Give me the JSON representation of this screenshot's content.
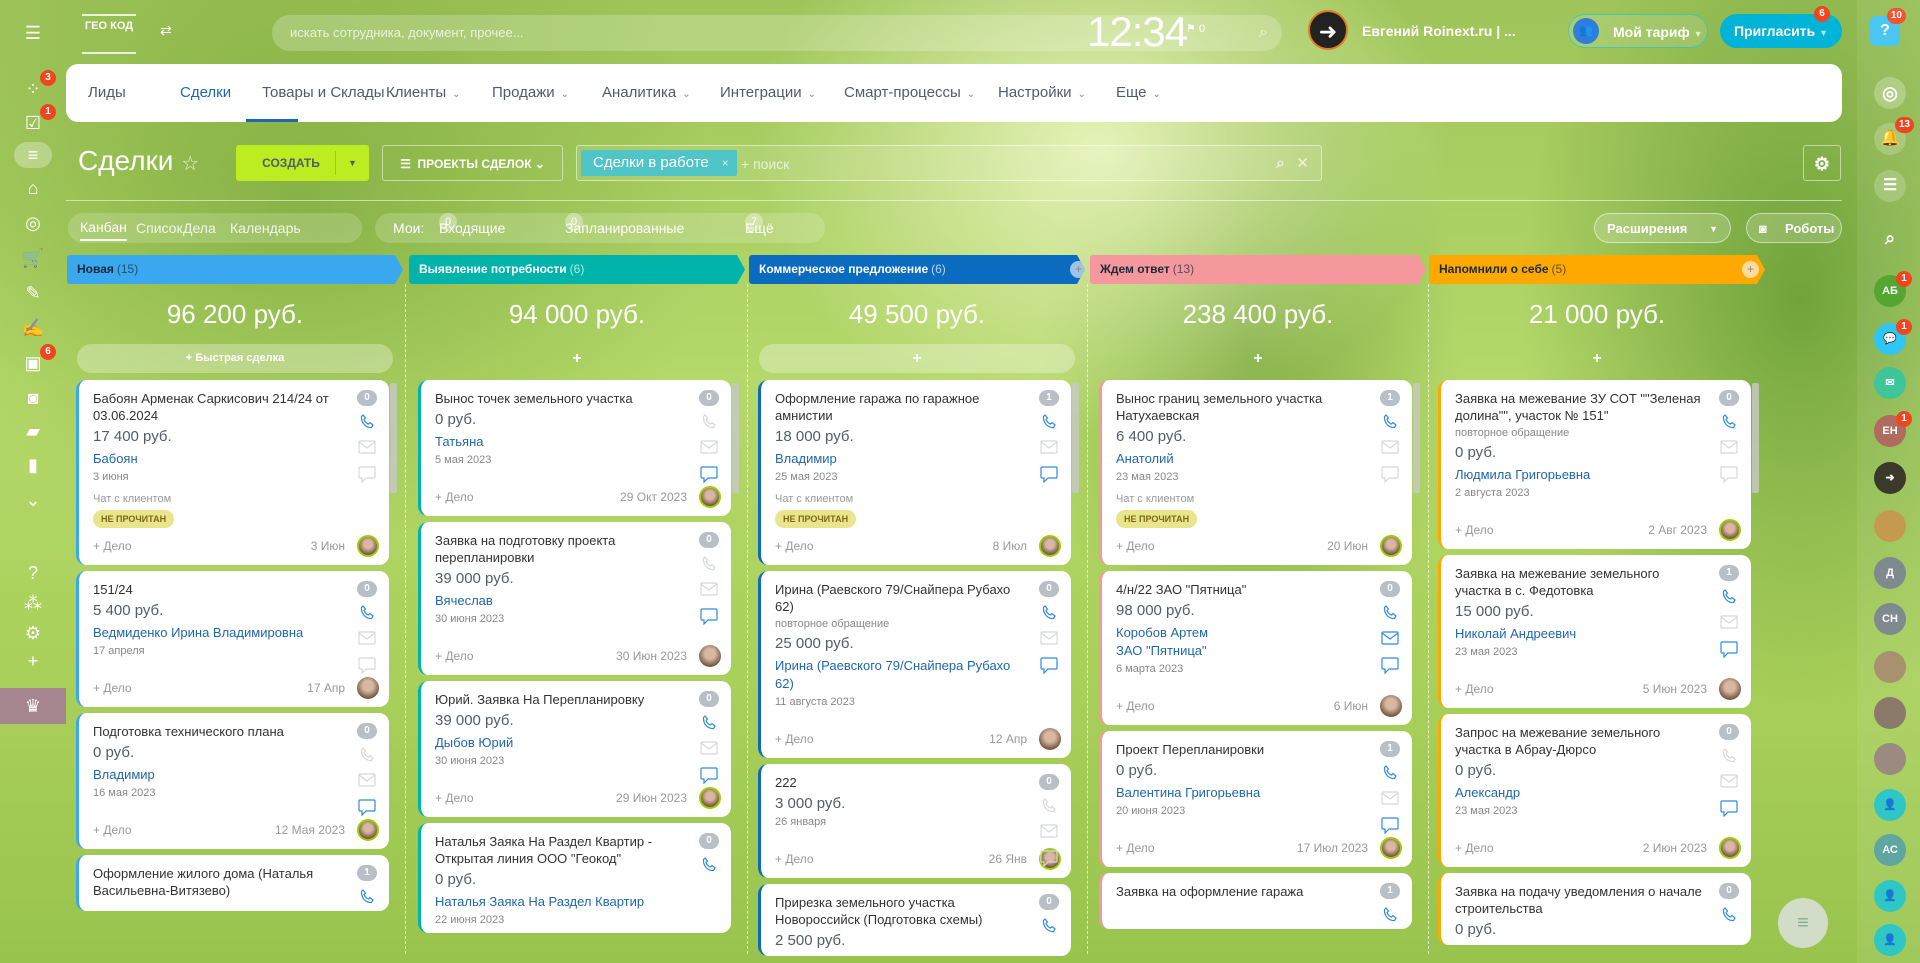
{
  "left_sidebar": {
    "items": [
      {
        "icon": "menu-icon",
        "glyph": "☰",
        "badge": null
      },
      {
        "icon": "feed-icon",
        "glyph": "⁘",
        "badge": "3"
      },
      {
        "icon": "tasks-icon",
        "glyph": "☑",
        "badge": "1"
      },
      {
        "icon": "crm-filter-icon",
        "glyph": "≡",
        "badge": null
      },
      {
        "icon": "store-icon",
        "glyph": "⌂",
        "badge": null
      },
      {
        "icon": "target-icon",
        "glyph": "◎",
        "badge": null
      },
      {
        "icon": "cart-icon",
        "glyph": "🛒",
        "badge": null
      },
      {
        "icon": "document-edit-icon",
        "glyph": "✎",
        "badge": null
      },
      {
        "icon": "signature-icon",
        "glyph": "✍",
        "badge": null
      },
      {
        "icon": "contact-card-icon",
        "glyph": "▣",
        "badge": "6"
      },
      {
        "icon": "robot-icon",
        "glyph": "◙",
        "badge": null
      },
      {
        "icon": "box-icon",
        "glyph": "▰",
        "badge": null
      },
      {
        "icon": "analytics-icon",
        "glyph": "▮",
        "badge": null
      },
      {
        "icon": "more-icon",
        "glyph": "⌄",
        "badge": null
      },
      {
        "icon": "help-icon",
        "glyph": "?",
        "badge": null
      },
      {
        "icon": "sitemap-icon",
        "glyph": "⁂",
        "badge": null
      },
      {
        "icon": "settings-icon",
        "glyph": "⚙",
        "badge": null
      },
      {
        "icon": "add-icon",
        "glyph": "+",
        "badge": null
      },
      {
        "icon": "crown-icon",
        "glyph": "♛",
        "badge": null
      }
    ]
  },
  "header": {
    "logo_text": "ГЕО КОД",
    "search_placeholder": "искать сотрудника, документ, прочее...",
    "clock": "12:34",
    "flag_count": "0",
    "user_name": "Евгений Roinext.ru | ...",
    "tariff_label": "Мой тариф",
    "invite_label": "Пригласить",
    "invite_badge": "6",
    "help_badge": "10"
  },
  "nav": {
    "items": [
      {
        "label": "Лиды",
        "dropdown": false
      },
      {
        "label": "Сделки",
        "dropdown": false,
        "active": true
      },
      {
        "label": "Товары и Склады",
        "dropdown": true
      },
      {
        "label": "Клиенты",
        "dropdown": true
      },
      {
        "label": "Продажи",
        "dropdown": true
      },
      {
        "label": "Аналитика",
        "dropdown": true
      },
      {
        "label": "Интеграции",
        "dropdown": true
      },
      {
        "label": "Смарт-процессы",
        "dropdown": true
      },
      {
        "label": "Настройки",
        "dropdown": true
      },
      {
        "label": "Еще",
        "dropdown": true
      }
    ]
  },
  "toolbar": {
    "title": "Сделки",
    "create_label": "СОЗДАТЬ",
    "projects_label": "ПРОЕКТЫ СДЕЛОК",
    "filter_tag": "Сделки в работе",
    "search_placeholder": "+ поиск"
  },
  "views": {
    "tabs": [
      "Канбан",
      "Список",
      "Дела",
      "Календарь"
    ],
    "my_label": "Мои:",
    "counters": [
      {
        "count": "0",
        "label": "Входящие"
      },
      {
        "count": "0",
        "label": "Запланированные"
      },
      {
        "count": "7",
        "label": "Ещё"
      }
    ],
    "extensions_label": "Расширения",
    "robots_label": "Роботы"
  },
  "columns": [
    {
      "title": "Новая",
      "count": "(15)",
      "sum": "96 200 руб.",
      "color": "#39a8ef",
      "text_color": "#1a2a3a",
      "quick": "Быстрая сделка",
      "cards": [
        {
          "title": "Бабоян Арменак Саркисович 214/24 от 03.06.2024",
          "amount": "17 400 руб.",
          "contacts": [
            "Бабоян"
          ],
          "date": "3 июня",
          "chat": "Чат с клиентом",
          "badge": "НЕ ПРОЧИТАН",
          "counter": "0",
          "foot_date": "3 Июн",
          "phone": true,
          "mail": false,
          "msg": false,
          "add": "+ Дело"
        },
        {
          "title": "151/24",
          "amount": "5 400 руб.",
          "contacts": [
            "Ведмиденко Ирина Владимировна"
          ],
          "date": "17 апреля",
          "counter": "0",
          "foot_date": "17 Апр",
          "phone": true,
          "mail": false,
          "msg": false,
          "add": "+ Дело"
        },
        {
          "title": "Подготовка технического плана",
          "amount": "0 руб.",
          "contacts": [
            "Владимир"
          ],
          "date": "16 мая 2023",
          "counter": "0",
          "foot_date": "12 Мая 2023",
          "phone": false,
          "mail": false,
          "msg": true,
          "add": "+ Дело"
        },
        {
          "title": "Оформление жилого дома (Наталья Васильевна-Витязево)",
          "counter": "1",
          "phone": true
        }
      ]
    },
    {
      "title": "Выявление потребности",
      "count": "(6)",
      "sum": "94 000 руб.",
      "color": "#00b4ac",
      "text_color": "#ffffff",
      "quick": "+",
      "cards": [
        {
          "title": "Вынос точек земельного участка",
          "amount": "0 руб.",
          "contacts": [
            "Татьяна"
          ],
          "date": "5 мая 2023",
          "counter": "0",
          "foot_date": "29 Окт 2023",
          "phone": false,
          "mail": false,
          "msg": true,
          "add": "+ Дело"
        },
        {
          "title": "Заявка на подготовку проекта перепланировки",
          "amount": "39 000 руб.",
          "contacts": [
            "Вячеслав"
          ],
          "date": "30 июня 2023",
          "counter": "0",
          "foot_date": "30 Июн 2023",
          "phone": false,
          "mail": false,
          "msg": true,
          "add": "+ Дело"
        },
        {
          "title": "Юрий. Заявка На Перепланировку",
          "amount": "39 000 руб.",
          "contacts": [
            "Дыбов Юрий"
          ],
          "date": "30 июня 2023",
          "counter": "0",
          "foot_date": "29 Июн 2023",
          "phone": true,
          "mail": false,
          "msg": true,
          "add": "+ Дело"
        },
        {
          "title": "Наталья Заяка На Раздел Квартир - Открытая линия ООО \"Геокод\"",
          "amount": "0 руб.",
          "contacts": [
            "Наталья Заяка На Раздел Квартир"
          ],
          "date": "22 июня 2023",
          "counter": "0",
          "phone": true,
          "mail": false,
          "msg": true
        }
      ]
    },
    {
      "title": "Коммерческое предложение",
      "count": "(6)",
      "sum": "49 500 руб.",
      "color": "#0b6bc1",
      "text_color": "#ffffff",
      "quick": "+",
      "quick_filled": true,
      "cards": [
        {
          "title": "Оформление гаража по гаражное амнистии",
          "amount": "18 000 руб.",
          "contacts": [
            "Владимир"
          ],
          "date": "25 мая 2023",
          "chat": "Чат с клиентом",
          "badge": "НЕ ПРОЧИТАН",
          "counter": "1",
          "foot_date": "8 Июл",
          "phone": true,
          "mail": false,
          "msg": true,
          "add": "+ Дело"
        },
        {
          "title": "Ирина (Раевского 79/Снайпера Рубахо 62)",
          "subtitle": "повторное обращение",
          "amount": "25 000 руб.",
          "contacts": [
            "Ирина (Раевского 79/Снайпера Рубахо 62)"
          ],
          "date": "11 августа 2023",
          "counter": "0",
          "foot_date": "12 Апр",
          "phone": true,
          "mail": false,
          "msg": true,
          "add": "+ Дело"
        },
        {
          "title": "222",
          "amount": "3 000 руб.",
          "date": "26 января",
          "counter": "0",
          "foot_date": "26 Янв",
          "phone": false,
          "mail": false,
          "msg": false,
          "add": "+ Дело"
        },
        {
          "title": "Прирезка земельного участка Новороссийск (Подготовка схемы)",
          "amount": "2 500 руб.",
          "counter": "0",
          "phone": true
        }
      ]
    },
    {
      "title": "Ждем ответ",
      "count": "(13)",
      "sum": "238 400 руб.",
      "color": "#f4989d",
      "text_color": "#1a2a3a",
      "quick": "+",
      "cards": [
        {
          "title": "Вынос границ земельного участка Натухаевская",
          "amount": "6 400 руб.",
          "contacts": [
            "Анатолий"
          ],
          "date": "23 мая 2023",
          "chat": "Чат с клиентом",
          "badge": "НЕ ПРОЧИТАН",
          "counter": "1",
          "foot_date": "20 Июн",
          "phone": true,
          "mail": false,
          "msg": false,
          "add": "+ Дело"
        },
        {
          "title": "4/н/22 ЗАО \"Пятница\"",
          "amount": "98 000 руб.",
          "contacts": [
            "Коробов Артем",
            "ЗАО \"Пятница\""
          ],
          "date": "6 марта 2023",
          "counter": "0",
          "foot_date": "6 Июн",
          "phone": true,
          "mail": true,
          "msg": true,
          "add": "+ Дело"
        },
        {
          "title": "Проект Перепланировки",
          "amount": "0 руб.",
          "contacts": [
            "Валентина Григорьевна"
          ],
          "date": "20 июня 2023",
          "counter": "1",
          "foot_date": "17 Июл 2023",
          "phone": true,
          "mail": false,
          "msg": true,
          "add": "+ Дело"
        },
        {
          "title": "Заявка на оформление гаража",
          "counter": "1",
          "phone": true
        }
      ]
    },
    {
      "title": "Напомнили о себе",
      "count": "(5)",
      "sum": "21 000 руб.",
      "color": "#ffa900",
      "text_color": "#1a2a3a",
      "quick": "+",
      "cards": [
        {
          "title": "Заявка на межевание ЗУ СОТ \"\"Зеленая долина\"\", участок № 151\"",
          "subtitle": "повторное обращение",
          "amount": "0 руб.",
          "contacts": [
            "Людмила Григорьевна"
          ],
          "date": "2 августа 2023",
          "counter": "0",
          "foot_date": "2 Авг 2023",
          "phone": true,
          "mail": false,
          "msg": false,
          "add": "+ Дело"
        },
        {
          "title": "Заявка на межевание земельного участка в с. Федотовка",
          "amount": "15 000 руб.",
          "contacts": [
            "Николай Андреевич"
          ],
          "date": "23 мая 2023",
          "counter": "1",
          "foot_date": "5 Июн 2023",
          "phone": true,
          "mail": false,
          "msg": true,
          "add": "+ Дело"
        },
        {
          "title": "Запрос на межевание земельного участка в Абрау-Дюрсо",
          "amount": "0 руб.",
          "contacts": [
            "Александр"
          ],
          "date": "23 мая 2023",
          "counter": "0",
          "foot_date": "2 Июн 2023",
          "phone": false,
          "mail": false,
          "msg": true,
          "add": "+ Дело"
        },
        {
          "title": "Заявка на подачу уведомления о начале строительства",
          "amount": "0 руб.",
          "counter": "0",
          "phone": true
        }
      ]
    }
  ],
  "right_sidebar": {
    "notifications_badge": "13",
    "avatars": [
      {
        "text": "АБ",
        "color": "#55a630",
        "badge": "1"
      },
      {
        "text": "💬",
        "color": "#2fc6f6",
        "badge": "1"
      },
      {
        "text": "✉",
        "color": "#3fc59a",
        "badge": null
      },
      {
        "text": "ЕН",
        "color": "#b06a5e",
        "badge": "1"
      },
      {
        "text": "➜",
        "color": "#3a3a2a",
        "badge": null
      },
      {
        "text": "",
        "color": "#c49a50",
        "badge": null
      },
      {
        "text": "Д",
        "color": "#7f8a8e",
        "badge": null
      },
      {
        "text": "СН",
        "color": "#7f8a8e",
        "badge": null
      },
      {
        "text": "",
        "color": "#a8916f",
        "badge": null
      },
      {
        "text": "",
        "color": "#8a7a6a",
        "badge": null
      },
      {
        "text": "",
        "color": "#9a8a80",
        "badge": null
      },
      {
        "text": "👤",
        "color": "#2fc6c6",
        "badge": null
      },
      {
        "text": "АС",
        "color": "#5fa5a0",
        "badge": null
      },
      {
        "text": "👤",
        "color": "#2fc6c6",
        "badge": null
      },
      {
        "text": "👤",
        "color": "#2fc6c6",
        "badge": null
      }
    ]
  },
  "colors": {
    "accent": "#2067b0",
    "create": "#bbed21",
    "invite": "#00b4d8"
  }
}
